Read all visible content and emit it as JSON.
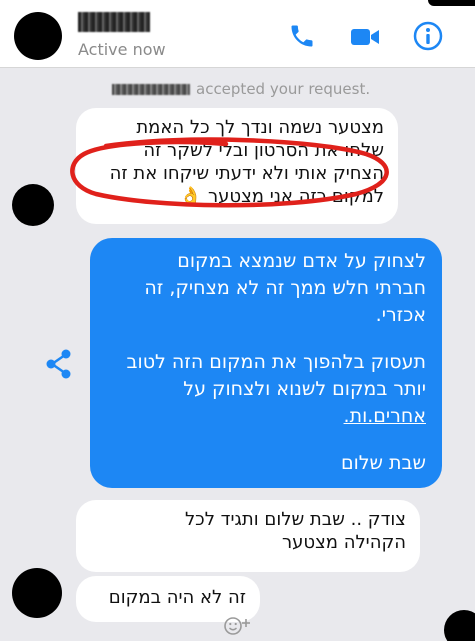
{
  "header": {
    "status": "Active now",
    "icons": [
      "phone-icon",
      "video-icon",
      "info-icon"
    ]
  },
  "system": {
    "accepted_text": "accepted your request."
  },
  "messages": {
    "incoming1": {
      "lines": [
        "מצטער נשמה ונדך לך כל האמת",
        "שלחו את הסרטון ובלי לשקר זה",
        "הצחיק אותי ולא ידעתי שיקחו את זה",
        "למקום כזה אני מצטער 👌"
      ]
    },
    "outgoing1": {
      "lines": [
        "לצחוק על אדם שנמצא במקום",
        "חברתי חלש ממך זה לא מצחיק, זה",
        "אכזרי.",
        "",
        "תעסוק בלהפוך את המקום הזה לטוב",
        "יותר במקום לשנוא ולצחוק על",
        "אחרים.ות.",
        "",
        "שבת שלום"
      ]
    },
    "incoming2": {
      "lines": [
        "צודק .. שבת שלום ותגיד לכל",
        "הקהילה מצטער"
      ]
    },
    "incoming3": {
      "text": "זה לא היה במקום"
    }
  },
  "colors": {
    "accent": "#1d87f4",
    "background": "#e9e9ed",
    "incoming_bubble": "#ffffff",
    "annotation": "#e0211b"
  }
}
